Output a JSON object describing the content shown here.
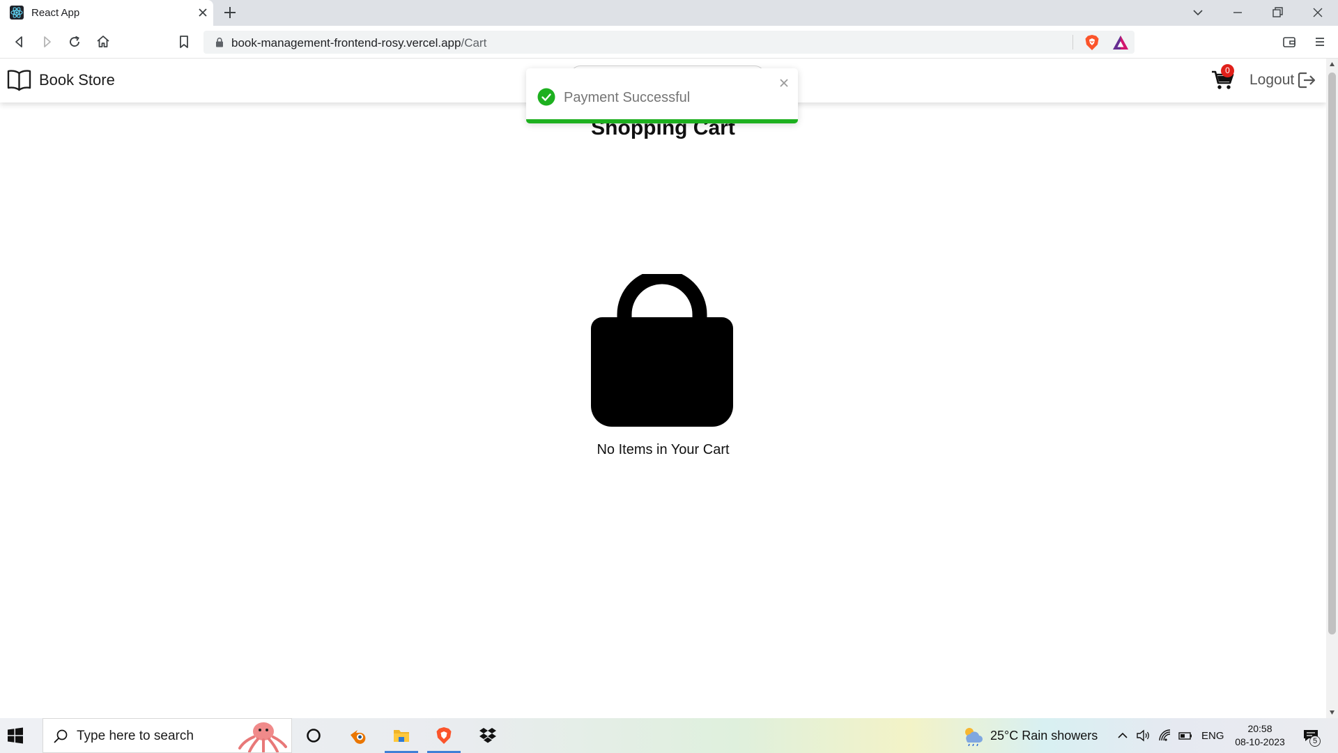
{
  "browser": {
    "tab_title": "React App",
    "url_host": "book-management-frontend-rosy.vercel.app",
    "url_path": "/Cart"
  },
  "navbar": {
    "brand": "Book Store",
    "cart_count": "0",
    "logout_label": "Logout"
  },
  "page": {
    "heading": "Shopping Cart",
    "empty_message": "No Items in Your Cart"
  },
  "toast": {
    "message": "Payment Successful",
    "type": "success",
    "progress": 1.0
  },
  "taskbar": {
    "search_placeholder": "Type here to search",
    "weather": "25°C  Rain showers",
    "language": "ENG",
    "time": "20:58",
    "date": "08-10-2023",
    "notification_count": "5"
  },
  "colors": {
    "toast_success": "#1db01f",
    "cart_badge": "#e0201a",
    "brave_orange": "#fb542b"
  },
  "icons": [
    "react-favicon",
    "back-icon",
    "forward-icon",
    "reload-icon",
    "home-icon",
    "bookmark-icon",
    "lock-icon",
    "brave-shield-icon",
    "brave-rewards-icon",
    "wallet-icon",
    "menu-icon",
    "book-icon",
    "cart-icon",
    "logout-icon",
    "shopping-bag-icon",
    "check-circle-icon",
    "close-icon",
    "windows-start-icon",
    "search-icon",
    "cortana-icon",
    "blender-icon",
    "file-explorer-icon",
    "brave-icon",
    "dropbox-icon",
    "weather-icon",
    "chevron-up-icon",
    "volume-icon",
    "wifi-icon",
    "battery-icon",
    "notification-icon"
  ]
}
